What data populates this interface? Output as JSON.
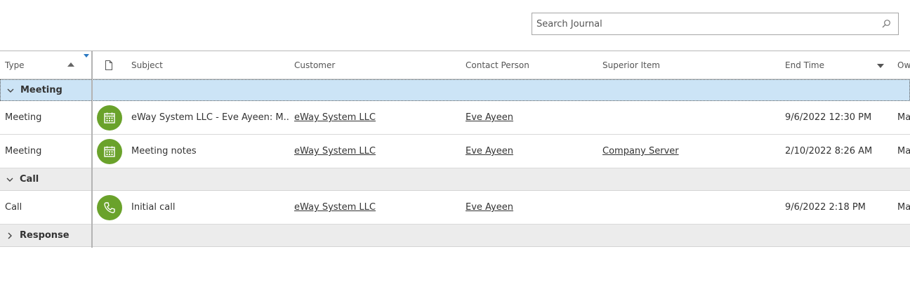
{
  "search": {
    "placeholder": "Search Journal"
  },
  "columns": {
    "type": "Type",
    "subject": "Subject",
    "customer": "Customer",
    "contact_person": "Contact Person",
    "superior_item": "Superior Item",
    "end_time": "End Time",
    "owner": "Ow"
  },
  "groups": {
    "meeting": "Meeting",
    "call": "Call",
    "response": "Response"
  },
  "rows": [
    {
      "type": "Meeting",
      "icon": "calendar-icon",
      "subject": "eWay System LLC - Eve Ayeen: M...",
      "customer": "eWay System LLC",
      "contact_person": "Eve Ayeen",
      "superior_item": "",
      "end_time": "9/6/2022 12:30 PM",
      "owner": "Ma"
    },
    {
      "type": "Meeting",
      "icon": "calendar-icon",
      "subject": "Meeting notes",
      "customer": "eWay System LLC",
      "contact_person": "Eve Ayeen",
      "superior_item": "Company Server",
      "end_time": "2/10/2022 8:26 AM",
      "owner": "Ma"
    },
    {
      "type": "Call",
      "icon": "phone-icon",
      "subject": "Initial call",
      "customer": "eWay System LLC",
      "contact_person": "Eve Ayeen",
      "superior_item": "",
      "end_time": "9/6/2022 2:18 PM",
      "owner": "Ma"
    }
  ],
  "colors": {
    "accent": "#6aa22b",
    "selected_group": "#cce4f6",
    "group_bg": "#ececec"
  }
}
